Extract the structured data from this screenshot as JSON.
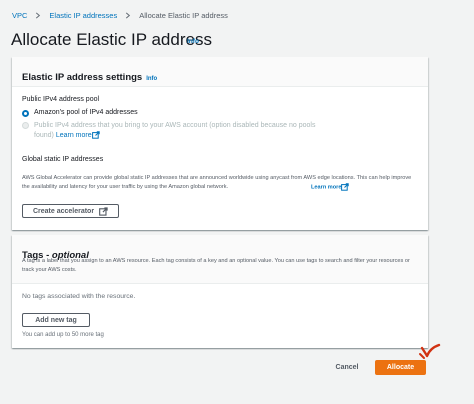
{
  "breadcrumb": {
    "items": [
      "VPC",
      "Elastic IP addresses"
    ],
    "current": "Allocate Elastic IP address"
  },
  "page": {
    "title": "Allocate Elastic IP address",
    "info": "Info"
  },
  "settings_panel": {
    "title": "Elastic IP address settings",
    "info": "Info",
    "pool_label": "Public IPv4 address pool",
    "option_amazon": "Amazon's pool of IPv4 addresses",
    "option_byoip_text": "Public IPv4 address that you bring to your AWS account (option disabled because no pools found)",
    "option_byoip_link": "Learn more",
    "selected_option": "Amazon's pool of IPv4 addresses",
    "global_static_label": "Global static IP addresses",
    "global_static_desc": "AWS Global Accelerator can provide global static IP addresses that are announced worldwide using anycast from AWS edge locations. This can help improve the availability and latency for your user traffic by using the Amazon global network.",
    "global_static_link": "Learn more",
    "create_accelerator_label": "Create accelerator"
  },
  "tags_panel": {
    "title_prefix": "Tags - ",
    "title_optional": "optional",
    "description": "A tag is a label that you assign to an AWS resource. Each tag consists of a key and an optional value. You can use tags to search and filter your resources or track your AWS costs.",
    "empty_text": "No tags associated with the resource.",
    "add_tag_label": "Add new tag",
    "limit_text": "You can add up to 50 more tag"
  },
  "footer": {
    "cancel_label": "Cancel",
    "allocate_label": "Allocate"
  },
  "colors": {
    "link": "#0073bb",
    "primary_button": "#ec7211",
    "annotation": "#d13212"
  },
  "icons": [
    "chevron-right-icon",
    "external-link-icon",
    "annotation-checkmark"
  ]
}
